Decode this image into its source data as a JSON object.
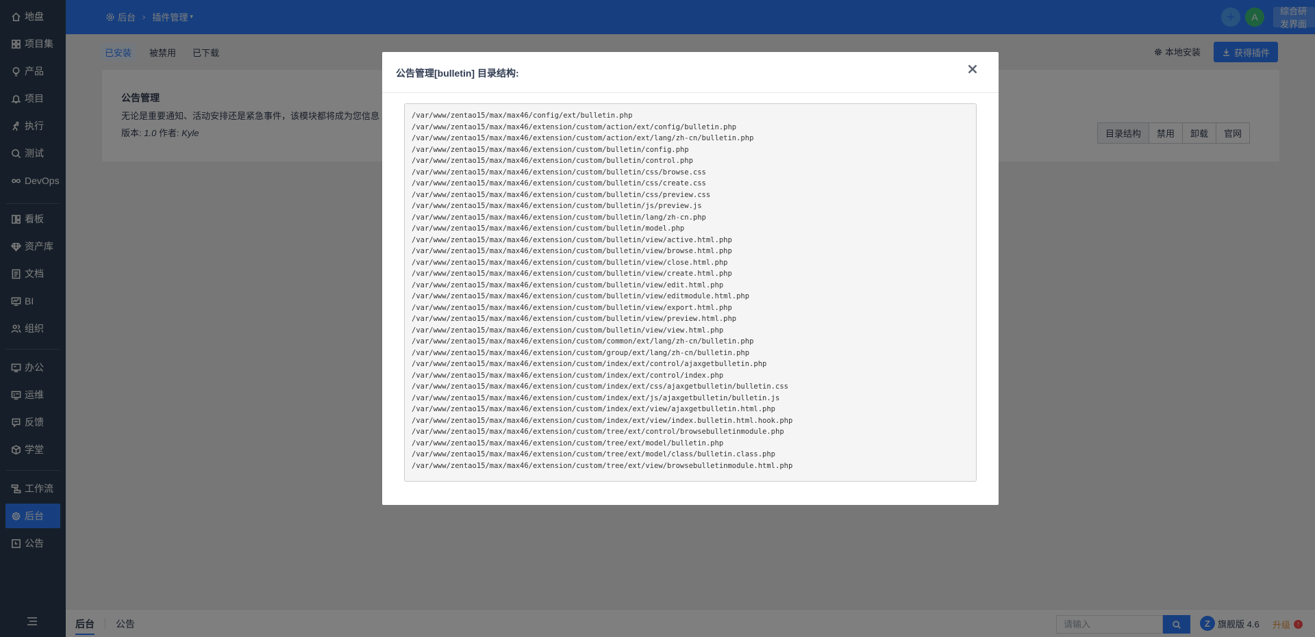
{
  "sidebar": {
    "items": [
      {
        "label": "地盘",
        "icon": "home-icon"
      },
      {
        "label": "项目集",
        "icon": "grid-icon"
      },
      {
        "label": "产品",
        "icon": "bulb-icon"
      },
      {
        "label": "项目",
        "icon": "bell-icon"
      },
      {
        "label": "执行",
        "icon": "run-icon"
      },
      {
        "label": "测试",
        "icon": "search-icon"
      },
      {
        "label": "DevOps",
        "icon": "infinity-icon"
      },
      {
        "label": "看板",
        "icon": "kanban-icon"
      },
      {
        "label": "资产库",
        "icon": "diamond-icon"
      },
      {
        "label": "文档",
        "icon": "doc-icon"
      },
      {
        "label": "BI",
        "icon": "monitor-icon"
      },
      {
        "label": "组织",
        "icon": "group-icon"
      },
      {
        "label": "办公",
        "icon": "office-icon"
      },
      {
        "label": "运维",
        "icon": "ops-icon"
      },
      {
        "label": "反馈",
        "icon": "feedback-icon"
      },
      {
        "label": "学堂",
        "icon": "cube-icon"
      },
      {
        "label": "工作流",
        "icon": "workflow-icon"
      },
      {
        "label": "后台",
        "icon": "gear-icon"
      },
      {
        "label": "公告",
        "icon": "notice-icon"
      }
    ],
    "active": "后台"
  },
  "header": {
    "breadcrumb": [
      "后台",
      "插件管理"
    ],
    "avatar_letter": "A",
    "switch_label": "综合研发界面"
  },
  "tabs": [
    "已安装",
    "被禁用",
    "已下载"
  ],
  "toolbar": {
    "local_install": "本地安装",
    "get_plugin": "获得插件"
  },
  "plugin": {
    "name": "公告管理",
    "description": "无论是重要通知、活动安排还是紧急事件，该模块都将成为您信息",
    "version_label": "版本:",
    "version": "1.0",
    "author_label": "作者:",
    "author": "Kyle",
    "actions": [
      "目录结构",
      "禁用",
      "卸载",
      "官网"
    ]
  },
  "modal": {
    "title": "公告管理[bulletin] 目录结构:",
    "files": [
      "/var/www/zentao15/max/max46/config/ext/bulletin.php",
      "/var/www/zentao15/max/max46/extension/custom/action/ext/config/bulletin.php",
      "/var/www/zentao15/max/max46/extension/custom/action/ext/lang/zh-cn/bulletin.php",
      "/var/www/zentao15/max/max46/extension/custom/bulletin/config.php",
      "/var/www/zentao15/max/max46/extension/custom/bulletin/control.php",
      "/var/www/zentao15/max/max46/extension/custom/bulletin/css/browse.css",
      "/var/www/zentao15/max/max46/extension/custom/bulletin/css/create.css",
      "/var/www/zentao15/max/max46/extension/custom/bulletin/css/preview.css",
      "/var/www/zentao15/max/max46/extension/custom/bulletin/js/preview.js",
      "/var/www/zentao15/max/max46/extension/custom/bulletin/lang/zh-cn.php",
      "/var/www/zentao15/max/max46/extension/custom/bulletin/model.php",
      "/var/www/zentao15/max/max46/extension/custom/bulletin/view/active.html.php",
      "/var/www/zentao15/max/max46/extension/custom/bulletin/view/browse.html.php",
      "/var/www/zentao15/max/max46/extension/custom/bulletin/view/close.html.php",
      "/var/www/zentao15/max/max46/extension/custom/bulletin/view/create.html.php",
      "/var/www/zentao15/max/max46/extension/custom/bulletin/view/edit.html.php",
      "/var/www/zentao15/max/max46/extension/custom/bulletin/view/editmodule.html.php",
      "/var/www/zentao15/max/max46/extension/custom/bulletin/view/export.html.php",
      "/var/www/zentao15/max/max46/extension/custom/bulletin/view/preview.html.php",
      "/var/www/zentao15/max/max46/extension/custom/bulletin/view/view.html.php",
      "/var/www/zentao15/max/max46/extension/custom/common/ext/lang/zh-cn/bulletin.php",
      "/var/www/zentao15/max/max46/extension/custom/group/ext/lang/zh-cn/bulletin.php",
      "/var/www/zentao15/max/max46/extension/custom/index/ext/control/ajaxgetbulletin.php",
      "/var/www/zentao15/max/max46/extension/custom/index/ext/control/index.php",
      "/var/www/zentao15/max/max46/extension/custom/index/ext/css/ajaxgetbulletin/bulletin.css",
      "/var/www/zentao15/max/max46/extension/custom/index/ext/js/ajaxgetbulletin/bulletin.js",
      "/var/www/zentao15/max/max46/extension/custom/index/ext/view/ajaxgetbulletin.html.php",
      "/var/www/zentao15/max/max46/extension/custom/index/ext/view/index.bulletin.html.hook.php",
      "/var/www/zentao15/max/max46/extension/custom/tree/ext/control/browsebulletinmodule.php",
      "/var/www/zentao15/max/max46/extension/custom/tree/ext/model/bulletin.php",
      "/var/www/zentao15/max/max46/extension/custom/tree/ext/model/class/bulletin.class.php",
      "/var/www/zentao15/max/max46/extension/custom/tree/ext/view/browsebulletinmodule.html.php"
    ]
  },
  "bottombar": {
    "tabs": [
      "后台",
      "公告"
    ],
    "search_placeholder": "请输入",
    "version": "旗舰版 4.6",
    "upgrade": "升级"
  },
  "colors": {
    "primary": "#2e7fff",
    "sidebar_bg": "#2c3e52",
    "upgrade": "#e8973c"
  }
}
